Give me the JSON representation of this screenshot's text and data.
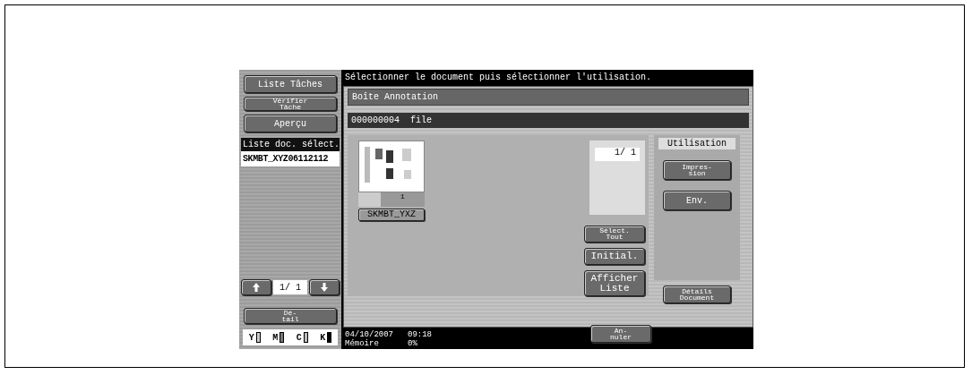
{
  "message": "Sélectionner le document puis sélectionner l'utilisation.",
  "left_buttons": [
    {
      "label": "Liste Tâches",
      "kind": "large"
    },
    {
      "label": "Vérifier\nTâche",
      "kind": "small"
    },
    {
      "label": "Aperçu",
      "kind": "large"
    }
  ],
  "doc_list": {
    "title": "Liste doc. sélect.",
    "items": [
      {
        "label": "SKMBT_XYZ06112112",
        "selected": true
      }
    ]
  },
  "doc_pager": "1/ 1",
  "detail_button": "Dé-\ntail",
  "toner": [
    "Y",
    "M",
    "C",
    "K"
  ],
  "box_title": "Boîte Annotation",
  "file_bar": "000000004  file",
  "thumbnail": {
    "page": "1",
    "name": "SKMBT_YXZ"
  },
  "page_counter": "1/ 1",
  "action_buttons": [
    {
      "label": "Sélect.\nTout",
      "kind": "small"
    },
    {
      "label": "Initial.",
      "kind": "large"
    },
    {
      "label": "Afficher\nListe",
      "kind": "large"
    }
  ],
  "usage": {
    "title": "Utilisation",
    "buttons": [
      "Impres-\nsion",
      "Env."
    ]
  },
  "details_button": "Détails\nDocument",
  "status": {
    "date": "04/10/2007",
    "time": "09:18",
    "memory_label": "Mémoire",
    "memory": "0%"
  },
  "cancel_button": "An-\nnuler"
}
